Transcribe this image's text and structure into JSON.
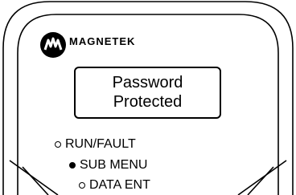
{
  "brand": {
    "name": "MAGNETEK",
    "logo_icon": "magnetek-logo-icon"
  },
  "display": {
    "line1": "Password",
    "line2": "Protected"
  },
  "indicators": [
    {
      "label": "RUN/FAULT",
      "state": "off"
    },
    {
      "label": "SUB MENU",
      "state": "on"
    },
    {
      "label": "DATA ENT",
      "state": "off"
    }
  ],
  "colors": {
    "outline": "#000000",
    "background": "#ffffff"
  }
}
